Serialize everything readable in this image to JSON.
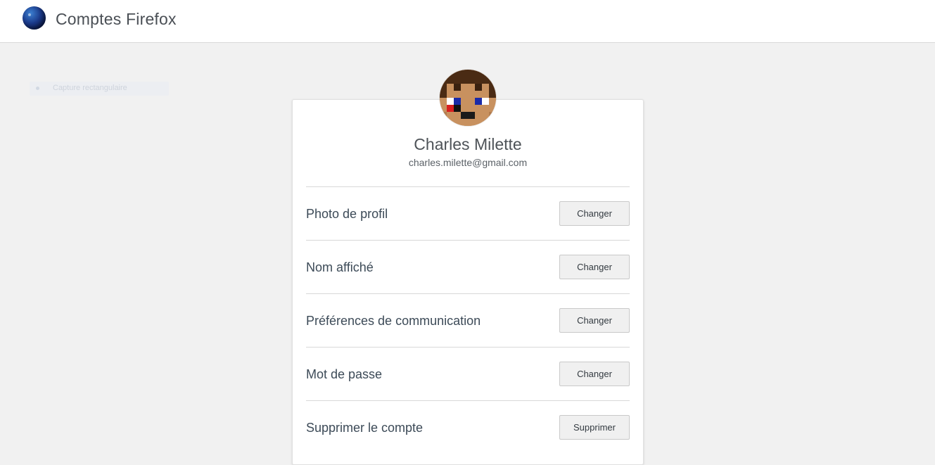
{
  "header": {
    "title": "Comptes Firefox",
    "logo_icon": "firefox-accounts-globe-icon"
  },
  "background_hint": {
    "text": "Capture rectangulaire"
  },
  "profile": {
    "name": "Charles Milette",
    "email": "charles.milette@gmail.com",
    "avatar_icon": "pixel-art-avatar"
  },
  "settings": [
    {
      "label": "Photo de profil",
      "button": "Changer"
    },
    {
      "label": "Nom affiché",
      "button": "Changer"
    },
    {
      "label": "Préférences de communication",
      "button": "Changer"
    },
    {
      "label": "Mot de passe",
      "button": "Changer"
    },
    {
      "label": "Supprimer le compte",
      "button": "Supprimer"
    }
  ],
  "colors": {
    "page_background": "#f1f1f1",
    "card_background": "#ffffff",
    "button_background": "#f0f0f0"
  }
}
